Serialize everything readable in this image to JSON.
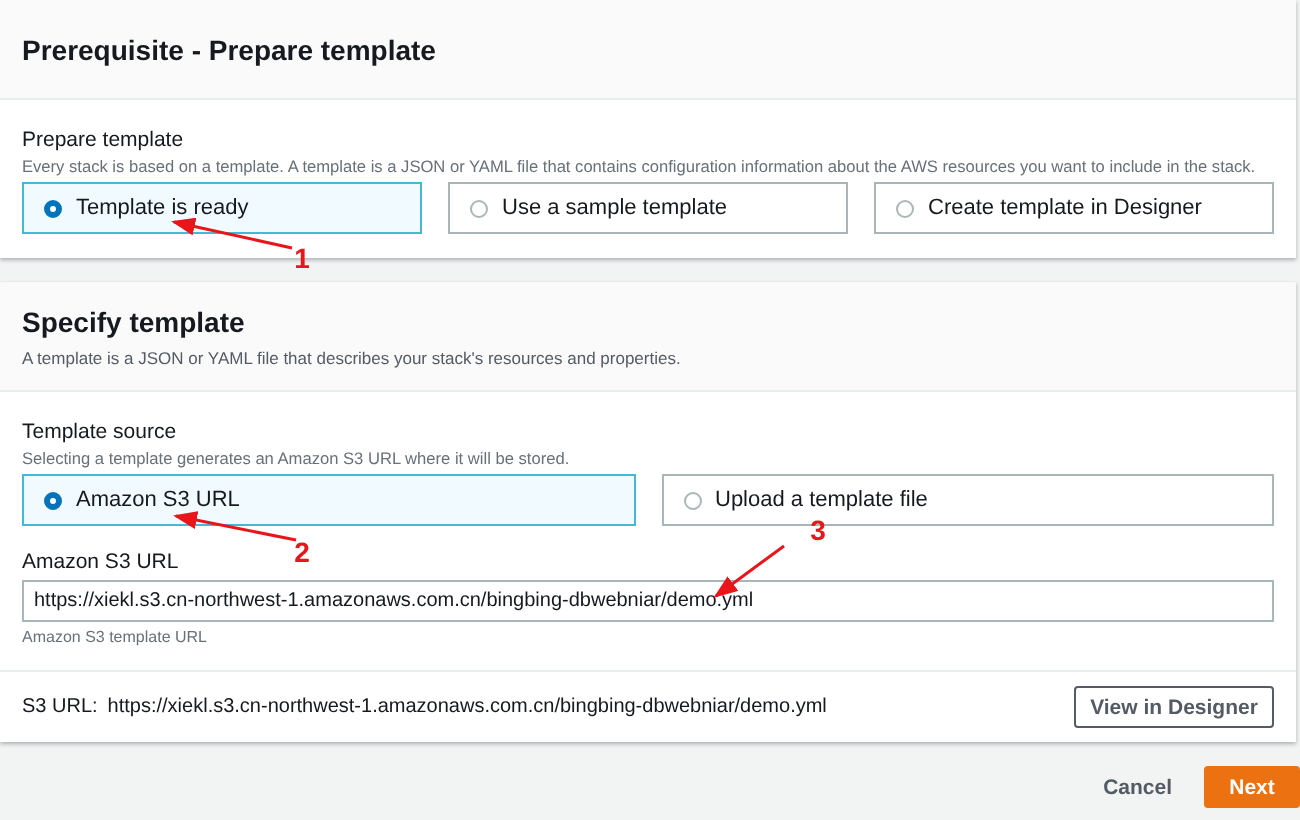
{
  "sections": [
    {
      "title": "Prerequisite - Prepare template",
      "field": {
        "label": "Prepare template",
        "description": "Every stack is based on a template. A template is a JSON or YAML file that contains configuration information about the AWS resources you want to include in the stack.",
        "options": [
          {
            "label": "Template is ready",
            "selected": true
          },
          {
            "label": "Use a sample template",
            "selected": false
          },
          {
            "label": "Create template in Designer",
            "selected": false
          }
        ]
      }
    },
    {
      "title": "Specify template",
      "description": "A template is a JSON or YAML file that describes your stack's resources and properties.",
      "field": {
        "label": "Template source",
        "description": "Selecting a template generates an Amazon S3 URL where it will be stored.",
        "options": [
          {
            "label": "Amazon S3 URL",
            "selected": true
          },
          {
            "label": "Upload a template file",
            "selected": false
          }
        ]
      },
      "url_field": {
        "label": "Amazon S3 URL",
        "value": "https://xiekl.s3.cn-northwest-1.amazonaws.com.cn/bingbing-dbwebniar/demo.yml",
        "hint": "Amazon S3 template URL"
      },
      "footer": {
        "label": "S3 URL:",
        "value": "https://xiekl.s3.cn-northwest-1.amazonaws.com.cn/bingbing-dbwebniar/demo.yml",
        "button": "View in Designer"
      }
    }
  ],
  "actions": {
    "cancel": "Cancel",
    "next": "Next"
  },
  "annotations": [
    {
      "label": "1"
    },
    {
      "label": "2"
    },
    {
      "label": "3"
    }
  ]
}
